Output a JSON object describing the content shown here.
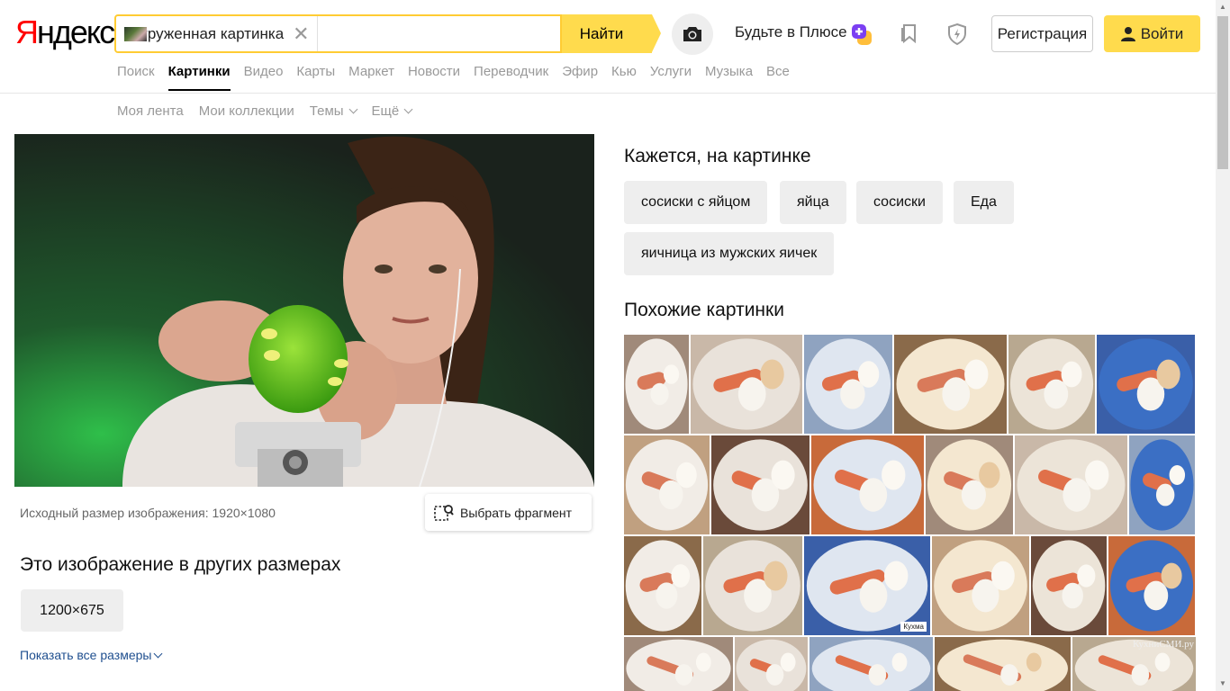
{
  "header": {
    "logo": "Яндекс",
    "logo_first_letter": "Я",
    "logo_rest": "ндекс",
    "search_chip_label": "Загруженная картинка",
    "find_button": "Найти",
    "plus_text": "Будьте в Плюсе",
    "register_button": "Регистрация",
    "login_button": "Войти"
  },
  "nav": {
    "items": [
      "Поиск",
      "Картинки",
      "Видео",
      "Карты",
      "Маркет",
      "Новости",
      "Переводчик",
      "Эфир",
      "Кью",
      "Услуги",
      "Музыка",
      "Все"
    ],
    "active": "Картинки"
  },
  "subnav": {
    "items": [
      "Моя лента",
      "Мои коллекции",
      "Темы",
      "Ещё"
    ]
  },
  "main": {
    "original_size_text": "Исходный размер изображения: 1920×1080",
    "select_fragment_button": "Выбрать фрагмент",
    "other_sizes_title": "Это изображение в других размерах",
    "size_option": "1200×675",
    "show_all_sizes": "Показать все размеры"
  },
  "right": {
    "seems_title": "Кажется, на картинке",
    "tags": [
      "сосиски с яйцом",
      "яйца",
      "сосиски",
      "Еда",
      "яичница из мужских яичек"
    ],
    "similar_title": "Похожие картинки",
    "watermarks": [
      "Кухма",
      "КухниСМИ.ру"
    ]
  },
  "colors": {
    "accent_yellow": "#ffdb4d",
    "logo_red": "#ff0000",
    "link_blue": "#1f4f8f",
    "tag_bg": "#eeeeee"
  }
}
